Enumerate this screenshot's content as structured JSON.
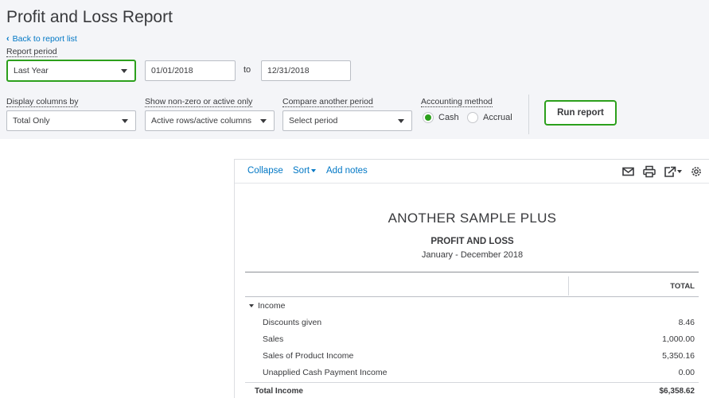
{
  "page_title": "Profit and Loss Report",
  "back_link": "Back to report list",
  "report_period": {
    "label": "Report period",
    "selected": "Last Year",
    "from_date": "01/01/2018",
    "to_label": "to",
    "to_date": "12/31/2018"
  },
  "display_columns": {
    "label": "Display columns by",
    "selected": "Total Only"
  },
  "show_nonzero": {
    "label": "Show non-zero or active only",
    "selected": "Active rows/active columns"
  },
  "compare_period": {
    "label": "Compare another period",
    "selected": "Select period"
  },
  "accounting_method": {
    "label": "Accounting method",
    "options": [
      "Cash",
      "Accrual"
    ],
    "selected": "Cash"
  },
  "run_report_label": "Run report",
  "toolbar": {
    "collapse": "Collapse",
    "sort": "Sort",
    "add_notes": "Add notes",
    "icons": [
      "email-icon",
      "print-icon",
      "export-icon",
      "gear-icon"
    ]
  },
  "report": {
    "company": "ANOTHER SAMPLE PLUS",
    "title": "PROFIT AND LOSS",
    "date_range": "January - December 2018",
    "column_header": "TOTAL",
    "section": "Income",
    "rows": [
      {
        "name": "Discounts given",
        "amount": "8.46"
      },
      {
        "name": "Sales",
        "amount": "1,000.00"
      },
      {
        "name": "Sales of Product Income",
        "amount": "5,350.16"
      },
      {
        "name": "Unapplied Cash Payment Income",
        "amount": "0.00"
      }
    ],
    "total": {
      "name": "Total Income",
      "amount": "$6,358.62"
    }
  },
  "colors": {
    "accent_green": "#2ca01c",
    "link_blue": "#0077c5",
    "panel_bg": "#f4f5f8"
  }
}
